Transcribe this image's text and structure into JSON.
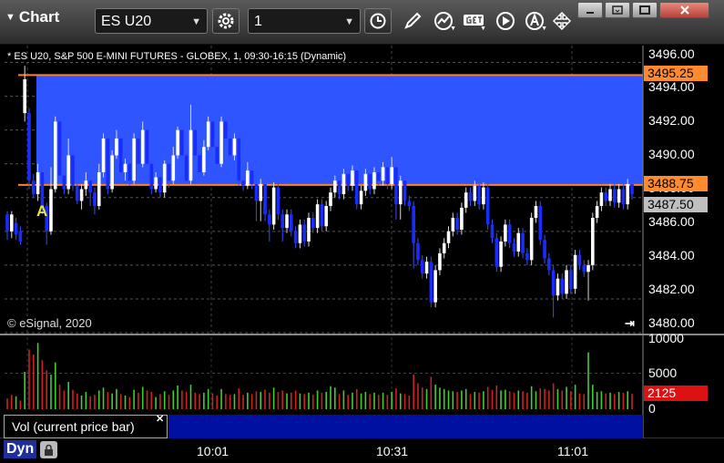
{
  "app": {
    "title": "Chart"
  },
  "toolbar": {
    "symbol": "ES U20",
    "interval": "1"
  },
  "icons": {
    "symbol_settings": "gear-icon",
    "interval_clock": "clock-icon",
    "draw": "pencil-icon",
    "studies": "studies-icon",
    "get": "get-icon",
    "play": "play-icon",
    "alert": "alert-icon",
    "cursor": "cursor-icon",
    "window": [
      "minimize-icon",
      "restore-icon",
      "maximize-icon",
      "close-icon"
    ]
  },
  "chart": {
    "subtitle": "* ES U20, S&P 500 E-MINI FUTURES - GLOBEX, 1, 09:30-16:15 (Dynamic)",
    "copyright": "© eSignal, 2020",
    "marker": "A",
    "price_axis": [
      "3496.00",
      "3494.00",
      "3492.00",
      "3490.00",
      "3488.00",
      "3486.00",
      "3484.00",
      "3482.00",
      "3480.00"
    ],
    "price_tags": {
      "upper_line": "3495.25",
      "lower_line": "3488.75",
      "last_price": "3487.50"
    },
    "volume_axis": [
      "10000",
      "5000",
      "0"
    ],
    "volume_tag": "2125",
    "volume_label": "Vol (current price bar)",
    "time_axis": [
      "10:01",
      "10:31",
      "11:01"
    ],
    "dyn_label": "Dyn",
    "colors": {
      "range_band": "#2e55ff",
      "range_line": "#ff8030",
      "up": "#ffffff",
      "down": "#1a2bff",
      "vol_up": "#44cc33",
      "vol_down": "#cc2222",
      "last_price_tag": "#c0c0c0",
      "volume_tag": "#dd1111"
    }
  },
  "chart_data": {
    "type": "candlestick",
    "title": "* ES U20, S&P 500 E-MINI FUTURES - GLOBEX, 1, 09:30-16:15 (Dynamic)",
    "ylim": [
      3480,
      3497
    ],
    "y_ticks": [
      3496,
      3494,
      3492,
      3490,
      3488,
      3486,
      3484,
      3482,
      3480
    ],
    "x_ticks": [
      "10:01",
      "10:31",
      "11:01"
    ],
    "reference_lines": [
      3495.25,
      3488.75
    ],
    "last_price": 3487.5,
    "volume_ylim": [
      0,
      10000
    ],
    "last_volume": 2125,
    "candles": [
      [
        3487.0,
        3486.0,
        3487.2,
        3485.5
      ],
      [
        3486.0,
        3487.0,
        3487.2,
        3485.6
      ],
      [
        3486.5,
        3485.8,
        3486.8,
        3485.5
      ],
      [
        3486.0,
        3485.4,
        3486.3,
        3485.2
      ],
      [
        3493.0,
        3495.0,
        3495.8,
        3492.5
      ],
      [
        3493.0,
        3489.0,
        3493.3,
        3488.5
      ],
      [
        3489.0,
        3488.2,
        3489.4,
        3488.0
      ],
      [
        3488.2,
        3489.5,
        3490.0,
        3487.8
      ],
      [
        3489.5,
        3487.5,
        3489.8,
        3487.0
      ],
      [
        3487.5,
        3486.0,
        3487.7,
        3485.2
      ],
      [
        3486.0,
        3488.5,
        3489.8,
        3485.8
      ],
      [
        3488.5,
        3492.5,
        3492.8,
        3488.3
      ],
      [
        3492.5,
        3489.3,
        3492.8,
        3489.0
      ],
      [
        3489.3,
        3488.5,
        3490.0,
        3488.2
      ],
      [
        3488.5,
        3490.5,
        3491.5,
        3488.2
      ],
      [
        3490.5,
        3488.7,
        3491.0,
        3488.4
      ],
      [
        3488.7,
        3487.8,
        3489.0,
        3487.6
      ],
      [
        3487.8,
        3488.5,
        3488.8,
        3487.3
      ],
      [
        3488.5,
        3489.0,
        3489.5,
        3488.1
      ],
      [
        3489.0,
        3488.3,
        3489.2,
        3487.5
      ],
      [
        3488.3,
        3487.5,
        3488.6,
        3487.0
      ],
      [
        3487.5,
        3489.5,
        3490.0,
        3487.3
      ],
      [
        3489.5,
        3491.5,
        3491.8,
        3489.2
      ],
      [
        3491.5,
        3488.5,
        3491.8,
        3488.2
      ],
      [
        3488.5,
        3490.5,
        3490.8,
        3488.3
      ],
      [
        3490.5,
        3491.5,
        3492.0,
        3490.3
      ],
      [
        3491.5,
        3489.5,
        3491.8,
        3489.2
      ],
      [
        3489.5,
        3490.0,
        3490.3,
        3489.0
      ],
      [
        3490.0,
        3489.0,
        3490.2,
        3488.7
      ],
      [
        3489.0,
        3491.5,
        3491.8,
        3488.8
      ],
      [
        3491.5,
        3490.0,
        3491.8,
        3489.7
      ],
      [
        3490.0,
        3492.0,
        3492.5,
        3489.8
      ],
      [
        3492.0,
        3490.0,
        3492.3,
        3489.7
      ],
      [
        3490.0,
        3488.5,
        3490.3,
        3488.2
      ],
      [
        3488.5,
        3489.2,
        3489.5,
        3488.3
      ],
      [
        3489.2,
        3488.3,
        3489.5,
        3488.0
      ],
      [
        3488.3,
        3490.0,
        3490.2,
        3488.0
      ],
      [
        3490.0,
        3489.0,
        3490.3,
        3488.6
      ],
      [
        3489.0,
        3490.5,
        3491.0,
        3488.8
      ],
      [
        3490.5,
        3492.0,
        3492.2,
        3490.3
      ],
      [
        3492.0,
        3490.5,
        3492.3,
        3490.3
      ],
      [
        3490.5,
        3489.0,
        3490.8,
        3488.8
      ],
      [
        3489.0,
        3492.0,
        3493.5,
        3488.8
      ],
      [
        3492.0,
        3490.5,
        3492.3,
        3490.3
      ],
      [
        3490.5,
        3489.5,
        3490.7,
        3489.2
      ],
      [
        3489.5,
        3491.0,
        3491.4,
        3489.3
      ],
      [
        3491.0,
        3492.5,
        3492.8,
        3490.8
      ],
      [
        3492.5,
        3491.0,
        3492.8,
        3490.7
      ],
      [
        3491.0,
        3490.0,
        3491.3,
        3489.7
      ],
      [
        3490.0,
        3492.5,
        3492.8,
        3489.8
      ],
      [
        3492.5,
        3491.5,
        3492.8,
        3491.2
      ],
      [
        3491.5,
        3490.5,
        3491.8,
        3490.2
      ],
      [
        3490.5,
        3491.5,
        3491.8,
        3490.2
      ],
      [
        3491.5,
        3489.0,
        3491.7,
        3488.7
      ],
      [
        3489.0,
        3488.7,
        3489.2,
        3488.4
      ],
      [
        3488.7,
        3489.6,
        3490.1,
        3488.5
      ],
      [
        3489.6,
        3488.8,
        3489.9,
        3488.5
      ],
      [
        3488.8,
        3487.8,
        3489.1,
        3486.6
      ],
      [
        3487.8,
        3488.8,
        3489.1,
        3486.6
      ],
      [
        3488.8,
        3487.0,
        3489.1,
        3486.6
      ],
      [
        3487.0,
        3486.4,
        3487.3,
        3485.4
      ],
      [
        3486.4,
        3488.6,
        3488.9,
        3486.1
      ],
      [
        3488.6,
        3487.0,
        3488.9,
        3486.7
      ],
      [
        3487.0,
        3486.2,
        3487.3,
        3485.4
      ],
      [
        3486.2,
        3487.0,
        3487.3,
        3485.9
      ],
      [
        3487.0,
        3486.0,
        3487.3,
        3485.7
      ],
      [
        3486.0,
        3485.3,
        3486.3,
        3485.0
      ],
      [
        3485.3,
        3486.4,
        3486.7,
        3485.0
      ],
      [
        3486.4,
        3485.4,
        3486.7,
        3485.1
      ],
      [
        3485.4,
        3486.8,
        3487.1,
        3485.1
      ],
      [
        3486.8,
        3486.2,
        3487.1,
        3485.9
      ],
      [
        3486.2,
        3487.6,
        3487.9,
        3485.9
      ],
      [
        3487.6,
        3486.3,
        3487.9,
        3486.0
      ],
      [
        3486.3,
        3487.5,
        3487.8,
        3486.0
      ],
      [
        3487.5,
        3488.3,
        3488.6,
        3487.2
      ],
      [
        3488.3,
        3489.0,
        3489.3,
        3488.0
      ],
      [
        3489.0,
        3488.2,
        3489.3,
        3487.9
      ],
      [
        3488.2,
        3489.4,
        3489.7,
        3487.9
      ],
      [
        3489.4,
        3488.7,
        3489.7,
        3488.4
      ],
      [
        3488.7,
        3489.6,
        3489.9,
        3488.4
      ],
      [
        3489.6,
        3487.6,
        3489.9,
        3487.3
      ],
      [
        3487.6,
        3488.4,
        3488.7,
        3487.3
      ],
      [
        3488.4,
        3489.4,
        3489.7,
        3488.1
      ],
      [
        3489.4,
        3488.5,
        3489.7,
        3488.2
      ],
      [
        3488.5,
        3489.5,
        3489.8,
        3488.2
      ],
      [
        3489.5,
        3489.0,
        3489.8,
        3488.7
      ],
      [
        3489.0,
        3489.8,
        3490.1,
        3488.7
      ],
      [
        3489.8,
        3488.8,
        3490.1,
        3488.5
      ],
      [
        3488.8,
        3489.8,
        3490.4,
        3488.5
      ],
      [
        3489.8,
        3487.6,
        3490.1,
        3486.7
      ],
      [
        3487.6,
        3489.0,
        3489.3,
        3486.7
      ],
      [
        3489.0,
        3487.8,
        3489.3,
        3487.5
      ],
      [
        3487.8,
        3487.5,
        3488.1,
        3487.2
      ],
      [
        3487.5,
        3485.3,
        3487.8,
        3483.8
      ],
      [
        3485.3,
        3484.3,
        3485.6,
        3484.0
      ],
      [
        3484.3,
        3483.5,
        3484.6,
        3483.2
      ],
      [
        3483.5,
        3484.2,
        3484.5,
        3483.2
      ],
      [
        3484.2,
        3481.8,
        3484.5,
        3481.5
      ],
      [
        3481.8,
        3483.7,
        3484.0,
        3481.5
      ],
      [
        3483.7,
        3484.7,
        3485.0,
        3483.4
      ],
      [
        3484.7,
        3485.3,
        3485.6,
        3484.4
      ],
      [
        3485.3,
        3486.0,
        3486.3,
        3485.0
      ],
      [
        3486.0,
        3486.8,
        3487.1,
        3485.7
      ],
      [
        3486.8,
        3486.1,
        3487.1,
        3485.8
      ],
      [
        3486.1,
        3487.4,
        3487.7,
        3485.8
      ],
      [
        3487.4,
        3488.3,
        3488.6,
        3487.1
      ],
      [
        3488.3,
        3487.8,
        3488.6,
        3487.5
      ],
      [
        3487.8,
        3488.7,
        3489.0,
        3487.5
      ],
      [
        3488.7,
        3487.6,
        3489.0,
        3487.3
      ],
      [
        3487.6,
        3488.6,
        3488.9,
        3487.3
      ],
      [
        3488.6,
        3486.4,
        3488.9,
        3486.1
      ],
      [
        3486.4,
        3485.6,
        3486.7,
        3485.3
      ],
      [
        3485.6,
        3483.9,
        3485.9,
        3483.6
      ],
      [
        3483.9,
        3485.4,
        3485.7,
        3483.6
      ],
      [
        3485.4,
        3486.4,
        3486.7,
        3485.1
      ],
      [
        3486.4,
        3485.3,
        3486.7,
        3485.0
      ],
      [
        3485.3,
        3484.8,
        3485.6,
        3484.5
      ],
      [
        3484.8,
        3485.9,
        3486.2,
        3484.5
      ],
      [
        3485.9,
        3484.7,
        3486.2,
        3484.4
      ],
      [
        3484.7,
        3484.3,
        3485.0,
        3484.0
      ],
      [
        3484.3,
        3486.8,
        3487.1,
        3484.0
      ],
      [
        3486.8,
        3487.5,
        3487.8,
        3486.5
      ],
      [
        3487.5,
        3485.5,
        3487.8,
        3485.2
      ],
      [
        3485.5,
        3484.4,
        3485.8,
        3484.1
      ],
      [
        3484.4,
        3483.7,
        3484.7,
        3483.4
      ],
      [
        3483.7,
        3482.2,
        3484.0,
        3480.9
      ],
      [
        3482.2,
        3483.2,
        3483.5,
        3481.9
      ],
      [
        3483.2,
        3482.3,
        3483.5,
        3482.0
      ],
      [
        3482.3,
        3483.7,
        3484.0,
        3482.0
      ],
      [
        3483.7,
        3482.6,
        3484.0,
        3482.3
      ],
      [
        3482.6,
        3484.6,
        3484.9,
        3482.3
      ],
      [
        3484.6,
        3484.0,
        3484.9,
        3483.7
      ],
      [
        3484.0,
        3483.6,
        3484.3,
        3483.3
      ],
      [
        3483.6,
        3484.0,
        3484.3,
        3481.9
      ],
      [
        3484.0,
        3486.8,
        3487.1,
        3483.7
      ],
      [
        3486.8,
        3487.5,
        3487.8,
        3486.5
      ],
      [
        3487.5,
        3488.3,
        3488.6,
        3487.2
      ],
      [
        3488.3,
        3487.8,
        3488.6,
        3487.5
      ],
      [
        3487.8,
        3488.5,
        3488.8,
        3487.5
      ],
      [
        3488.5,
        3487.7,
        3488.8,
        3487.4
      ],
      [
        3487.7,
        3488.5,
        3488.8,
        3487.4
      ],
      [
        3488.5,
        3487.6,
        3488.8,
        3487.3
      ],
      [
        3487.6,
        3488.8,
        3489.1,
        3487.3
      ],
      [
        3488.8,
        3488.2,
        3489.2,
        3487.9
      ]
    ],
    "volume": [
      [
        1500,
        0
      ],
      [
        2000,
        0
      ],
      [
        1800,
        1
      ],
      [
        1200,
        0
      ],
      [
        5200,
        1
      ],
      [
        8300,
        0
      ],
      [
        7600,
        0
      ],
      [
        9200,
        1
      ],
      [
        6800,
        0
      ],
      [
        5400,
        0
      ],
      [
        4800,
        1
      ],
      [
        6500,
        1
      ],
      [
        3400,
        0
      ],
      [
        2600,
        0
      ],
      [
        3800,
        1
      ],
      [
        2700,
        0
      ],
      [
        2200,
        0
      ],
      [
        1900,
        1
      ],
      [
        2400,
        1
      ],
      [
        1800,
        0
      ],
      [
        2000,
        0
      ],
      [
        2600,
        1
      ],
      [
        3000,
        1
      ],
      [
        2400,
        0
      ],
      [
        2200,
        1
      ],
      [
        2800,
        1
      ],
      [
        2100,
        0
      ],
      [
        1900,
        1
      ],
      [
        1700,
        0
      ],
      [
        2700,
        1
      ],
      [
        2300,
        0
      ],
      [
        3100,
        1
      ],
      [
        2600,
        0
      ],
      [
        2400,
        0
      ],
      [
        1700,
        1
      ],
      [
        2100,
        0
      ],
      [
        2500,
        1
      ],
      [
        2000,
        0
      ],
      [
        2600,
        1
      ],
      [
        3300,
        1
      ],
      [
        2600,
        0
      ],
      [
        2400,
        0
      ],
      [
        3400,
        1
      ],
      [
        2300,
        0
      ],
      [
        2100,
        0
      ],
      [
        2300,
        1
      ],
      [
        2800,
        1
      ],
      [
        2200,
        0
      ],
      [
        1900,
        0
      ],
      [
        2800,
        1
      ],
      [
        2100,
        0
      ],
      [
        2000,
        0
      ],
      [
        2100,
        1
      ],
      [
        2900,
        0
      ],
      [
        2000,
        0
      ],
      [
        2300,
        1
      ],
      [
        2100,
        0
      ],
      [
        2500,
        0
      ],
      [
        2400,
        1
      ],
      [
        2700,
        0
      ],
      [
        2300,
        0
      ],
      [
        3000,
        1
      ],
      [
        2400,
        0
      ],
      [
        2600,
        0
      ],
      [
        2200,
        1
      ],
      [
        2300,
        0
      ],
      [
        2600,
        0
      ],
      [
        2200,
        1
      ],
      [
        2100,
        0
      ],
      [
        2300,
        1
      ],
      [
        2000,
        0
      ],
      [
        2600,
        1
      ],
      [
        2300,
        0
      ],
      [
        2400,
        1
      ],
      [
        3200,
        1
      ],
      [
        3000,
        1
      ],
      [
        2100,
        0
      ],
      [
        2600,
        1
      ],
      [
        2000,
        0
      ],
      [
        2300,
        1
      ],
      [
        2800,
        0
      ],
      [
        2200,
        1
      ],
      [
        2400,
        1
      ],
      [
        2100,
        0
      ],
      [
        2300,
        1
      ],
      [
        2000,
        0
      ],
      [
        2300,
        1
      ],
      [
        2000,
        0
      ],
      [
        2400,
        1
      ],
      [
        2900,
        0
      ],
      [
        2200,
        1
      ],
      [
        2100,
        0
      ],
      [
        1900,
        0
      ],
      [
        4800,
        0
      ],
      [
        3600,
        0
      ],
      [
        3000,
        0
      ],
      [
        2800,
        1
      ],
      [
        4500,
        0
      ],
      [
        3400,
        1
      ],
      [
        3000,
        1
      ],
      [
        2800,
        1
      ],
      [
        2600,
        1
      ],
      [
        2500,
        1
      ],
      [
        2400,
        0
      ],
      [
        2600,
        1
      ],
      [
        2800,
        1
      ],
      [
        2100,
        0
      ],
      [
        2400,
        1
      ],
      [
        2300,
        0
      ],
      [
        2500,
        1
      ],
      [
        3100,
        0
      ],
      [
        2700,
        0
      ],
      [
        3300,
        0
      ],
      [
        2600,
        1
      ],
      [
        2700,
        1
      ],
      [
        2500,
        0
      ],
      [
        2300,
        0
      ],
      [
        2600,
        1
      ],
      [
        2500,
        0
      ],
      [
        2300,
        0
      ],
      [
        3200,
        1
      ],
      [
        2500,
        1
      ],
      [
        2900,
        0
      ],
      [
        2800,
        0
      ],
      [
        2600,
        0
      ],
      [
        3600,
        0
      ],
      [
        2800,
        1
      ],
      [
        2600,
        0
      ],
      [
        3100,
        1
      ],
      [
        2500,
        0
      ],
      [
        3400,
        1
      ],
      [
        2200,
        0
      ],
      [
        2100,
        0
      ],
      [
        7900,
        1
      ],
      [
        3400,
        1
      ],
      [
        2400,
        1
      ],
      [
        2500,
        1
      ],
      [
        2200,
        0
      ],
      [
        2300,
        1
      ],
      [
        2100,
        0
      ],
      [
        2400,
        1
      ],
      [
        2300,
        0
      ],
      [
        2500,
        1
      ],
      [
        2125,
        0
      ]
    ]
  }
}
